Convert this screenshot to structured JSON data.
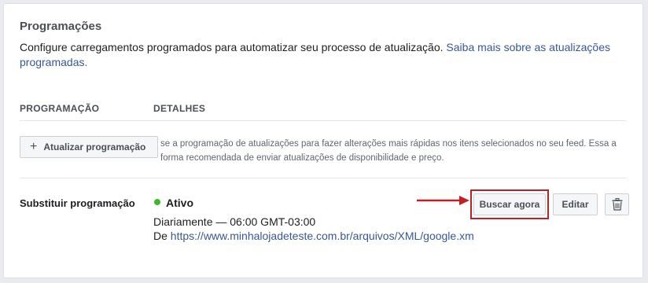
{
  "section": {
    "title": "Programações",
    "description": "Configure carregamentos programados para automatizar seu processo de atualização.",
    "learn_more_link": "Saiba mais sobre as atualizações programadas."
  },
  "table": {
    "headers": [
      "PROGRAMAÇÃO",
      "DETALHES"
    ]
  },
  "update_row": {
    "button_label": "Atualizar programação",
    "details": "se a programação de atualizações para fazer alterações mais rápidas nos itens selecionados no seu feed. Essa a forma recomendada de enviar atualizações de disponibilidade e preço."
  },
  "replace_row": {
    "label": "Substituir programação",
    "status": "Ativo",
    "status_color": "#42b72a",
    "schedule": "Diariamente — 06:00 GMT-03:00",
    "from_prefix": "De",
    "url": "https://www.minhalojadeteste.com.br/arquivos/XML/google.xm",
    "fetch_button": "Buscar agora",
    "edit_button": "Editar",
    "delete_icon": "trash-icon"
  },
  "annotation": {
    "highlight_color": "#c41e25"
  }
}
